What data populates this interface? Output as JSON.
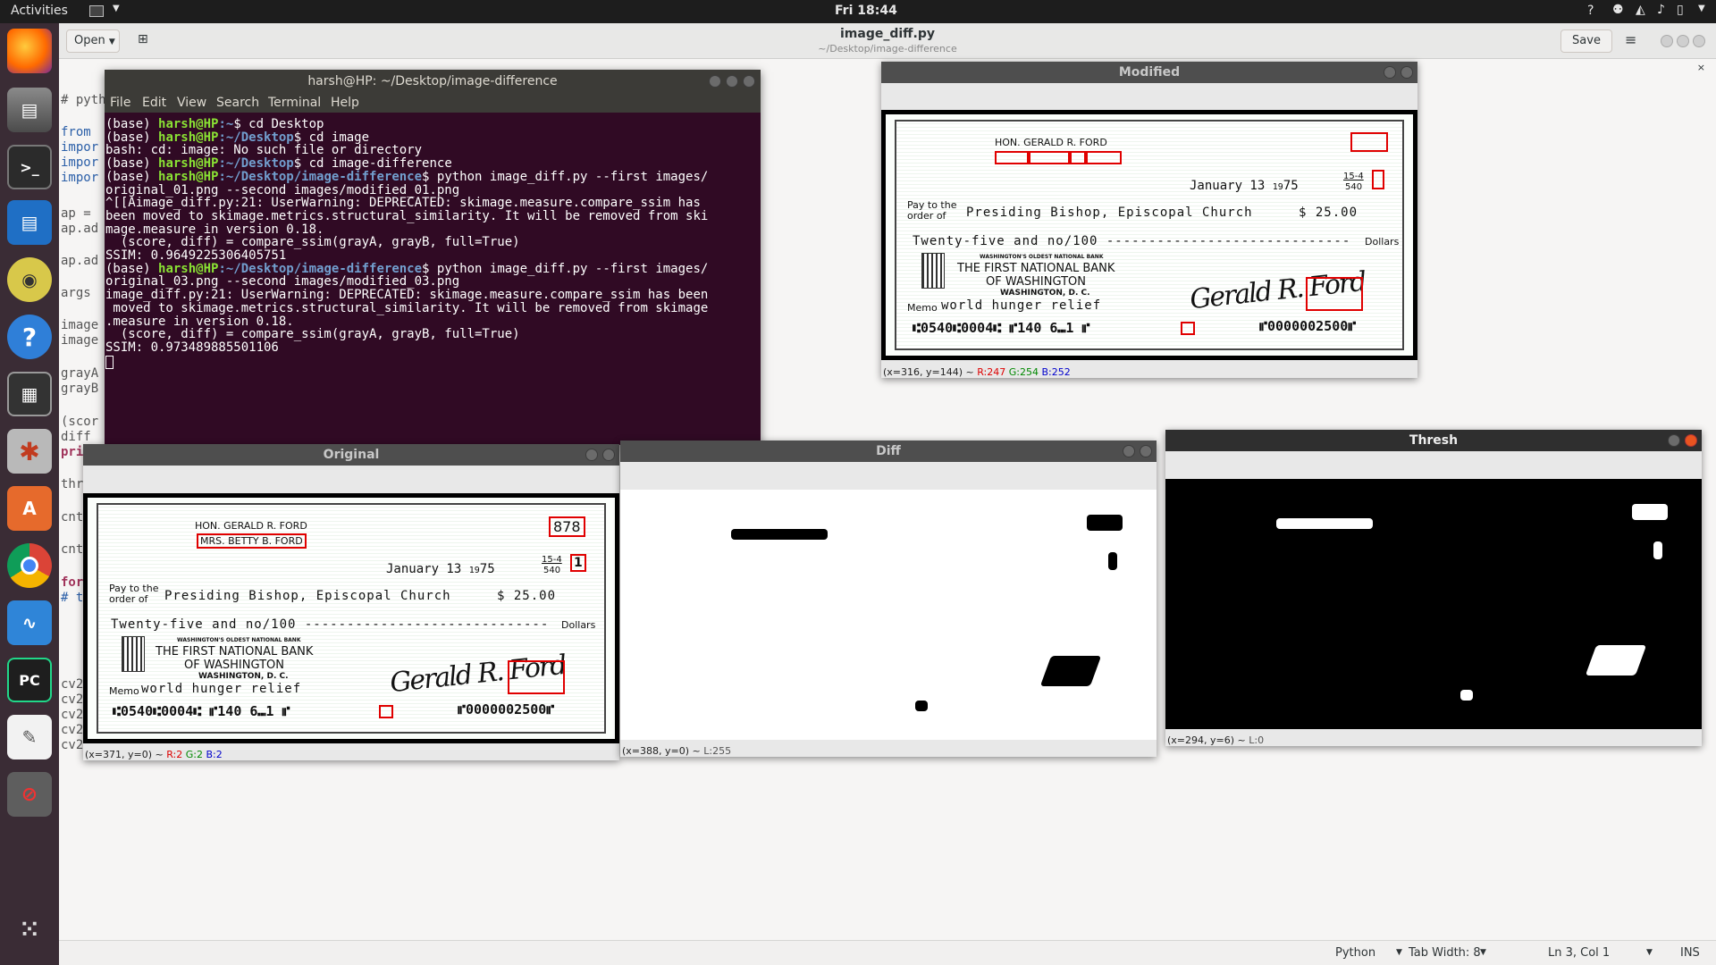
{
  "topbar": {
    "activities": "Activities",
    "clock": "Fri 18:44",
    "help": "?"
  },
  "gedit": {
    "open_label": "Open",
    "title": "image_diff.py",
    "subtitle": "~/Desktop/image-difference",
    "save_label": "Save",
    "code_fragments": [
      "# pyth",
      "from",
      "impor",
      "impor",
      "impor",
      "ap =",
      "ap.ad",
      "ap.ad",
      "args",
      "image",
      "image",
      "grayA",
      "grayB",
      "(scor",
      "diff",
      "pri",
      "thr",
      "cnt",
      "cnt",
      "for",
      "# t",
      "cv2",
      "cv2",
      "cv2",
      "cv2",
      "cv2"
    ],
    "status": {
      "language": "Python",
      "tab_width": "Tab Width: 8",
      "position": "Ln 3, Col 1",
      "mode": "INS"
    }
  },
  "terminal": {
    "title": "harsh@HP: ~/Desktop/image-difference",
    "menu": [
      "File",
      "Edit",
      "View",
      "Search",
      "Terminal",
      "Help"
    ],
    "lines": [
      {
        "env": "(base) ",
        "user": "harsh@HP",
        "path": ":~",
        "rest": "$ cd Desktop"
      },
      {
        "env": "(base) ",
        "user": "harsh@HP",
        "path": ":~/Desktop",
        "rest": "$ cd image"
      },
      {
        "plain": "bash: cd: image: No such file or directory"
      },
      {
        "env": "(base) ",
        "user": "harsh@HP",
        "path": ":~/Desktop",
        "rest": "$ cd image-difference"
      },
      {
        "env": "(base) ",
        "user": "harsh@HP",
        "path": ":~/Desktop/image-difference",
        "rest": "$ python image_diff.py --first images/"
      },
      {
        "plain": "original_01.png --second images/modified_01.png"
      },
      {
        "plain": "^[[Aimage_diff.py:21: UserWarning: DEPRECATED: skimage.measure.compare_ssim has"
      },
      {
        "plain": "been moved to skimage.metrics.structural_similarity. It will be removed from ski"
      },
      {
        "plain": "mage.measure in version 0.18."
      },
      {
        "plain": "  (score, diff) = compare_ssim(grayA, grayB, full=True)"
      },
      {
        "plain": "SSIM: 0.9649225306405751"
      },
      {
        "env": "(base) ",
        "user": "harsh@HP",
        "path": ":~/Desktop/image-difference",
        "rest": "$ python image_diff.py --first images/"
      },
      {
        "plain": "original_03.png --second images/modified_03.png"
      },
      {
        "plain": "image_diff.py:21: UserWarning: DEPRECATED: skimage.measure.compare_ssim has been"
      },
      {
        "plain": " moved to skimage.metrics.structural_similarity. It will be removed from skimage"
      },
      {
        "plain": ".measure in version 0.18."
      },
      {
        "plain": "  (score, diff) = compare_ssim(grayA, grayB, full=True)"
      },
      {
        "plain": "SSIM: 0.973489885501106"
      }
    ]
  },
  "check": {
    "payer": "HON. GERALD R. FORD",
    "payer2": "MRS. BETTY B. FORD",
    "number": "878",
    "date": "January 13",
    "year_prefix": "19",
    "year": "75",
    "routing_top": "15-4",
    "routing_bottom": "540",
    "routing_digit": "1",
    "pay_to": "Pay to the",
    "order_of": "order of",
    "payee": "Presiding Bishop, Episcopal Church",
    "amount": "$ 25.00",
    "words": "Twenty-five and no/100 -----------------------------",
    "dollars": "Dollars",
    "bank_tag": "WASHINGTON'S OLDEST NATIONAL BANK",
    "bank1": "THE FIRST NATIONAL BANK",
    "bank2": "OF WASHINGTON",
    "bank3": "WASHINGTON, D. C.",
    "memo_label": "Memo",
    "memo": "world hunger relief",
    "micr": "⑆0540⑆0004⑆  ⑈140  6⑉1  ⑈",
    "micr_amount": "⑈0000002500⑈",
    "signature": "Gerald R. Ford"
  },
  "windows": {
    "modified": {
      "title": "Modified",
      "status_xy": "(x=316, y=144) ~ ",
      "r": "R:247",
      "g": "G:254",
      "b": "B:252"
    },
    "original": {
      "title": "Original",
      "status_xy": "(x=371, y=0) ~ ",
      "r": "R:2",
      "g": "G:2",
      "b": "B:2"
    },
    "diff": {
      "title": "Diff",
      "status_xy": "(x=388, y=0) ~ ",
      "l": "L:255"
    },
    "thresh": {
      "title": "Thresh",
      "status_xy": "(x=294, y=6) ~ ",
      "l": "L:0"
    }
  },
  "colors": {
    "dock": "#3a2c35",
    "terminal_bg": "#300a24",
    "topbar": "#1d1d1d",
    "highlight_red": "#e00000"
  }
}
